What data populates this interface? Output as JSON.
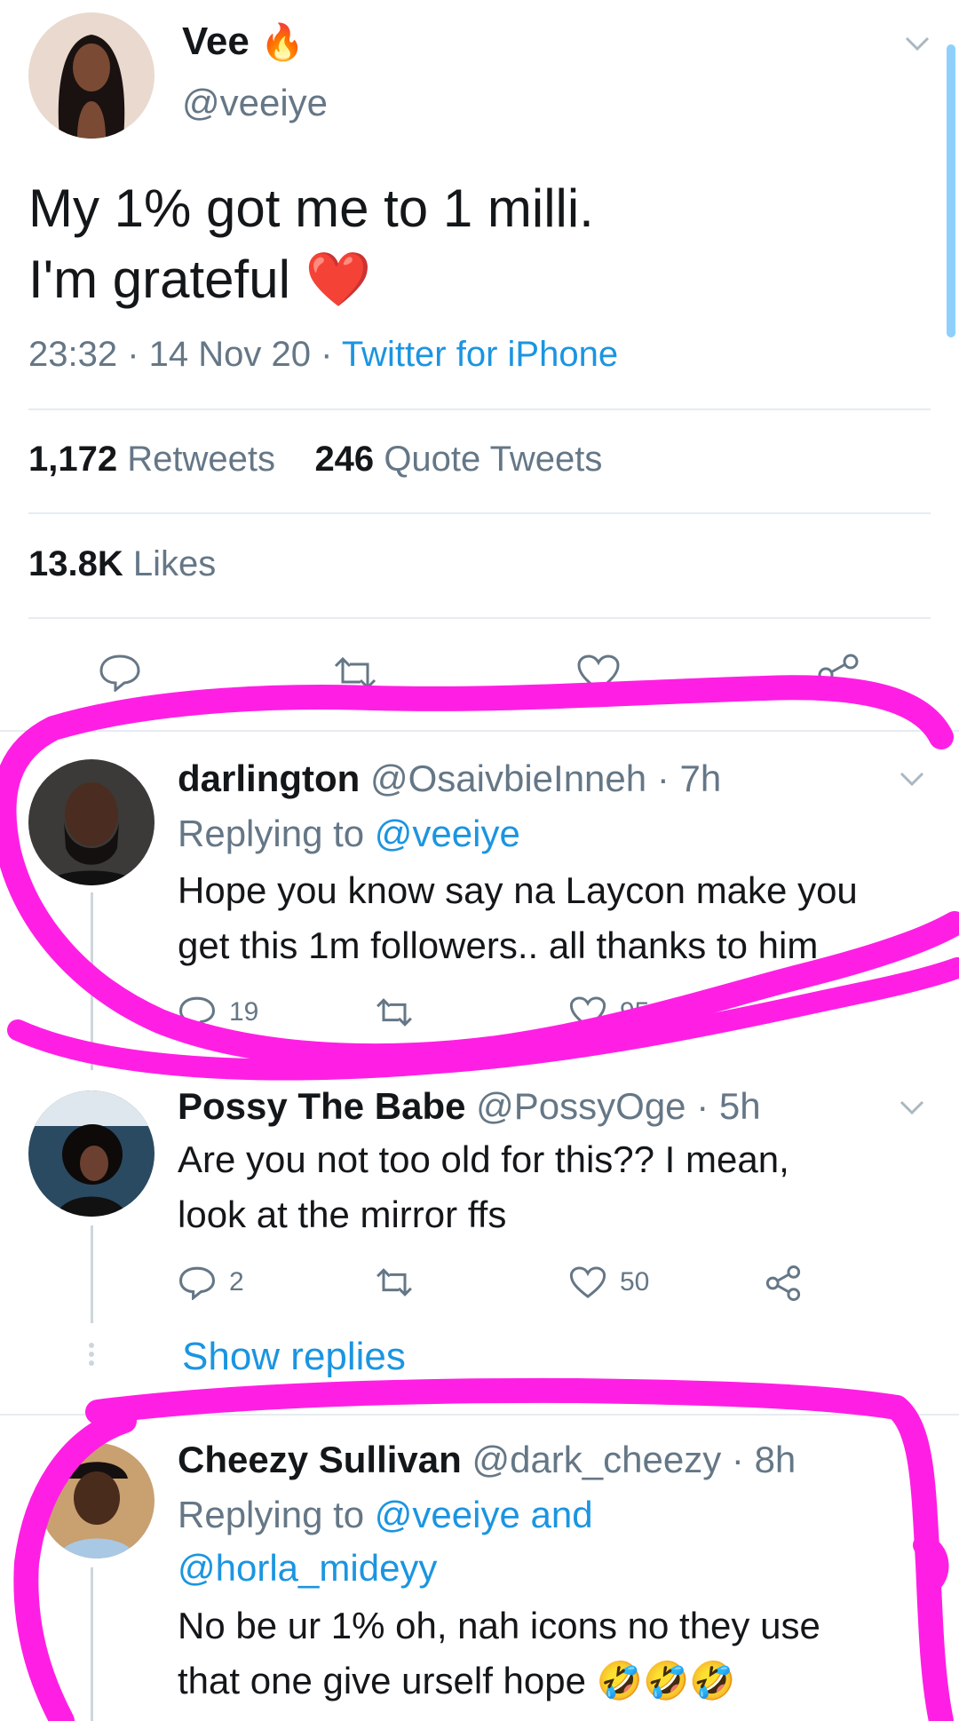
{
  "main_tweet": {
    "author_name": "Vee",
    "author_emoji": "🔥",
    "author_handle": "@veeiye",
    "text_line1": "My 1% got me to 1 milli.",
    "text_line2": "I'm grateful",
    "text_emoji": "❤️",
    "time": "23:32",
    "date": "14 Nov 20",
    "source": "Twitter for iPhone",
    "retweet_count": "1,172",
    "retweet_label": "Retweets",
    "quote_count": "246",
    "quote_label": "Quote Tweets",
    "like_count": "13.8K",
    "like_label": "Likes"
  },
  "replies": [
    {
      "name": "darlington",
      "handle": "@OsaivbieInneh",
      "time": "7h",
      "replying_prefix": "Replying to",
      "replying_to": "@veeiye",
      "text_line1": "Hope you know say na Laycon make you",
      "text_line2": "get this 1m followers.. all thanks to him",
      "reply_count": "19",
      "like_count": "95"
    },
    {
      "name": "Possy The Babe",
      "handle": "@PossyOge",
      "time": "5h",
      "text_line1": "Are you not too old for this?? I mean,",
      "text_line2": "look at the mirror ffs",
      "reply_count": "2",
      "like_count": "50",
      "show_replies": "Show replies"
    },
    {
      "name": "Cheezy Sullivan",
      "handle": "@dark_cheezy",
      "time": "8h",
      "replying_prefix": "Replying to",
      "replying_to_line1": "@veeiye and",
      "replying_to_line2": "@horla_mideyy",
      "text_line1": "No be ur 1% oh, nah icons no they use",
      "text_line2": "that one give urself hope",
      "text_emoji": "🤣🤣🤣"
    }
  ],
  "colors": {
    "link_blue": "#1b95e0",
    "muted_gray": "#657786",
    "highlight_magenta": "#ff1fe4"
  }
}
